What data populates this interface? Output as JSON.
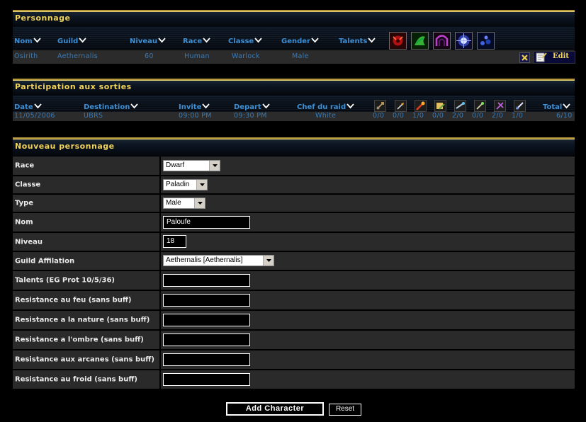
{
  "personnage": {
    "title": "Personnage",
    "columns": [
      "Nom",
      "Guild",
      "Niveau",
      "Race",
      "Classe",
      "Gender",
      "Talents"
    ],
    "row": {
      "nom": "Osirith",
      "guild": "Aethernalis",
      "niveau": "60",
      "race": "Human",
      "classe": "Warlock",
      "gender": "Male"
    },
    "talent_icons": [
      "demon-talent-icon",
      "affliction-talent-icon",
      "demonology-talent-icon",
      "arcane-talent-icon",
      "shadow-talent-icon"
    ],
    "edit_label": "Edit"
  },
  "sorties": {
    "title": "Participation aux sorties",
    "columns": [
      "Date",
      "Destination",
      "Invite",
      "Depart",
      "Chef du raid",
      "Total"
    ],
    "class_icons": [
      "warrior-icon",
      "rogue-icon",
      "mage-icon",
      "hunter-icon",
      "priest-icon",
      "druid-icon",
      "warlock-icon",
      "paladin-icon"
    ],
    "row": {
      "date": "11/05/2006",
      "destination": "UBRS",
      "invite": "09:00 PM",
      "depart": "09:30 PM",
      "chef": "White",
      "counts": [
        "0/0",
        "0/0",
        "1/0",
        "0/0",
        "2/0",
        "0/0",
        "2/0",
        "1/0"
      ],
      "total": "6/10"
    }
  },
  "nouveau": {
    "title": "Nouveau personnage",
    "race_label": "Race",
    "race_value": "Dwarf",
    "classe_label": "Classe",
    "classe_value": "Paladin",
    "type_label": "Type",
    "type_value": "Male",
    "nom_label": "Nom",
    "nom_value": "Paloufe",
    "niveau_label": "Niveau",
    "niveau_value": "18",
    "guild_label": "Guild Affilation",
    "guild_value": "Aethernalis [Aethernalis]",
    "talents_label": "Talents (EG Prot 10/5/36)",
    "feu_label": "Resistance au feu (sans buff)",
    "nature_label": "Resistance a la nature (sans buff)",
    "ombre_label": "Resistance a l'ombre (sans buff)",
    "arcanes_label": "Resistance aux arcanes (sans buff)",
    "froid_label": "Resistance au froid (sans buff)",
    "add_label": "Add Character",
    "reset_label": "Reset"
  }
}
